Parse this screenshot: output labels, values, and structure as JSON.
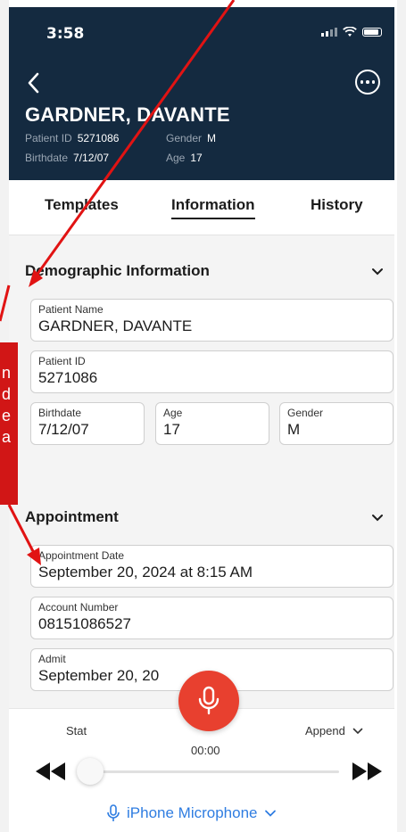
{
  "status_bar": {
    "time": "3:58"
  },
  "header": {
    "patient_name": "GARDNER, DAVANTE",
    "patient_id_label": "Patient ID",
    "patient_id": "5271086",
    "gender_label": "Gender",
    "gender": "M",
    "birthdate_label": "Birthdate",
    "birthdate": "7/12/07",
    "age_label": "Age",
    "age": "17"
  },
  "tabs": [
    {
      "label": "Templates"
    },
    {
      "label": "Information"
    },
    {
      "label": "History"
    }
  ],
  "demographic": {
    "title": "Demographic Information",
    "patient_name_label": "Patient Name",
    "patient_name": "GARDNER, DAVANTE",
    "patient_id_label": "Patient ID",
    "patient_id": "5271086",
    "birthdate_label": "Birthdate",
    "birthdate": "7/12/07",
    "age_label": "Age",
    "age": "17",
    "gender_label": "Gender",
    "gender": "M"
  },
  "appointment": {
    "title": "Appointment",
    "date_label": "Appointment Date",
    "date": "September 20, 2024 at 8:15 AM",
    "account_label": "Account Number",
    "account": "08151086527",
    "admit_label": "Admit",
    "admit": "September 20, 20"
  },
  "recorder": {
    "stat_label": "Stat",
    "append_label": "Append",
    "timer": "00:00",
    "mic_source": "iPhone Microphone"
  },
  "annotation": {
    "text_lines": [
      "n",
      "d",
      "e",
      "a"
    ],
    "color": "#d11616"
  },
  "colors": {
    "header_bg": "#142a40",
    "record_button": "#e8402f",
    "link_blue": "#2f7de1"
  }
}
